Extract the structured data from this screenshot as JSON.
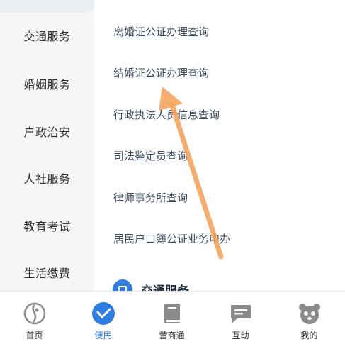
{
  "sidebar": {
    "items": [
      {
        "label": "交通服务"
      },
      {
        "label": "婚姻服务"
      },
      {
        "label": "户政治安"
      },
      {
        "label": "人社服务"
      },
      {
        "label": "教育考试"
      },
      {
        "label": "生活缴费"
      }
    ]
  },
  "main": {
    "links": [
      {
        "label": "离婚证公证办理查询"
      },
      {
        "label": "结婚证公证办理查询"
      },
      {
        "label": "行政执法人员信息查询"
      },
      {
        "label": "司法鉴定员查询"
      },
      {
        "label": "律师事务所查询"
      },
      {
        "label": "居民户口簿公证业务申办"
      }
    ],
    "section_label": "交通服务"
  },
  "tabbar": {
    "tabs": [
      {
        "label": "首页",
        "icon": "home-logo-icon"
      },
      {
        "label": "便民",
        "icon": "convenience-icon"
      },
      {
        "label": "营商通",
        "icon": "book-icon"
      },
      {
        "label": "互动",
        "icon": "chat-icon"
      },
      {
        "label": "我的",
        "icon": "panda-icon"
      }
    ],
    "active_index": 1
  },
  "colors": {
    "accent": "#2f7de1",
    "arrow": "#f4a460",
    "sidebar_bg": "#f5f6f8"
  }
}
